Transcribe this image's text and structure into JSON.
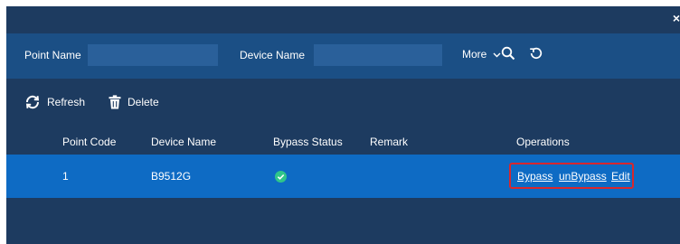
{
  "filter": {
    "point_name_label": "Point Name",
    "point_name_value": "",
    "device_name_label": "Device Name",
    "device_name_value": "",
    "more_label": "More"
  },
  "toolbar": {
    "refresh_label": "Refresh",
    "delete_label": "Delete"
  },
  "table": {
    "headers": [
      "Point Code",
      "Device Name",
      "Bypass Status",
      "Remark",
      "Operations"
    ],
    "rows": [
      {
        "point_code": "1",
        "device_name": "B9512G",
        "bypass_status": "check-circle-icon",
        "remark": "",
        "operations": [
          "Bypass",
          "unBypass",
          "Edit"
        ]
      }
    ]
  },
  "colors": {
    "background": "#1d3b60",
    "filter_bar": "#1b4f85",
    "selected_row": "#0e6bc4",
    "status_ok": "#2fc58a",
    "highlight_box": "#d8272d"
  }
}
